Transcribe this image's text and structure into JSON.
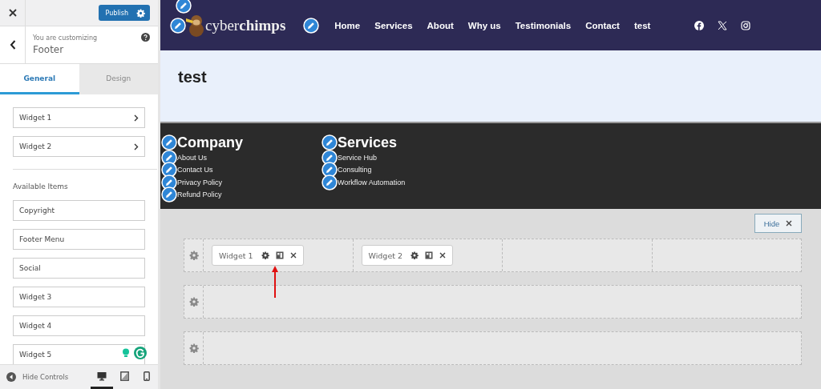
{
  "sidebar": {
    "publish_button": "Publish",
    "context_label": "You are customizing",
    "section_title": "Footer",
    "tabs": [
      {
        "label": "General",
        "selected": true
      },
      {
        "label": "Design",
        "selected": false
      }
    ],
    "active_widgets": [
      "Widget 1",
      "Widget 2"
    ],
    "available_heading": "Available Items",
    "available_items": [
      "Copyright",
      "Footer Menu",
      "Social",
      "Widget 3",
      "Widget 4",
      "Widget 5"
    ],
    "hide_controls": "Hide Controls",
    "devices": [
      {
        "kind": "desktop",
        "selected": true
      },
      {
        "kind": "tablet",
        "selected": false
      },
      {
        "kind": "mobile",
        "selected": false
      }
    ]
  },
  "preview": {
    "logo": "cyber**chimps**",
    "nav": [
      "Home",
      "Services",
      "About",
      "Why us",
      "Testimonials",
      "Contact",
      "test"
    ],
    "social": [
      {
        "kind": "facebook"
      },
      {
        "kind": "x"
      },
      {
        "kind": "instagram"
      }
    ],
    "page_title": "test",
    "footer_columns": [
      {
        "heading": "Company",
        "links": [
          "About Us",
          "Contact Us",
          "Privacy Policy",
          "Refund Policy"
        ]
      },
      {
        "heading": "Services",
        "links": [
          "Service Hub",
          "Consulting",
          "Workflow Automation"
        ]
      }
    ]
  },
  "builder": {
    "hide_button": "Hide",
    "rows": [
      {
        "kind": "four",
        "cells": [
          {
            "kind": "widget",
            "label": "Widget 1"
          },
          {
            "kind": "widget",
            "label": "Widget 2"
          },
          {
            "kind": "empty"
          },
          {
            "kind": "empty"
          }
        ]
      },
      {
        "kind": "single"
      },
      {
        "kind": "single"
      }
    ]
  }
}
